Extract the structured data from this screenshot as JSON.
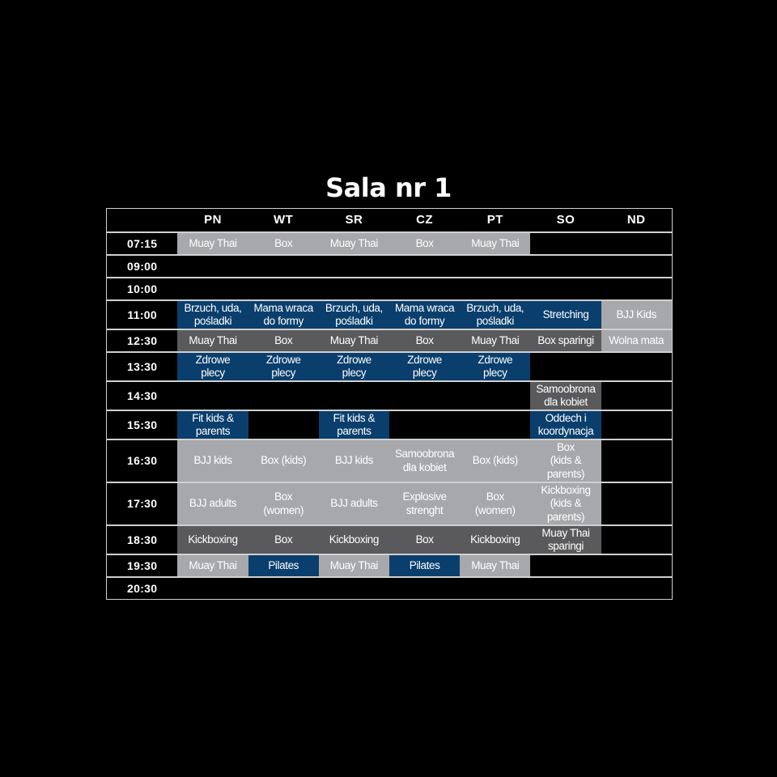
{
  "title": "Sala nr 1",
  "days": [
    "PN",
    "WT",
    "SR",
    "CZ",
    "PT",
    "SO",
    "ND"
  ],
  "colors": {
    "light": "#a7a8ab",
    "dark": "#5a5a5c",
    "blue": "#0a3f6d",
    "border": "#d0d0d0",
    "background": "#000000"
  },
  "rows": [
    {
      "time": "07:15",
      "cells": [
        {
          "label": "Muay Thai",
          "color": "light"
        },
        {
          "label": "Box",
          "color": "light"
        },
        {
          "label": "Muay Thai",
          "color": "light"
        },
        {
          "label": "Box",
          "color": "light"
        },
        {
          "label": "Muay Thai",
          "color": "light"
        },
        null,
        null
      ]
    },
    {
      "time": "09:00",
      "cells": [
        null,
        null,
        null,
        null,
        null,
        null,
        null
      ]
    },
    {
      "time": "10:00",
      "cells": [
        null,
        null,
        null,
        null,
        null,
        null,
        null
      ]
    },
    {
      "time": "11:00",
      "cells": [
        {
          "label": "Brzuch, uda,\npośladki",
          "color": "blue"
        },
        {
          "label": "Mama wraca\ndo formy",
          "color": "blue"
        },
        {
          "label": "Brzuch, uda,\npośladki",
          "color": "blue"
        },
        {
          "label": "Mama wraca\ndo formy",
          "color": "blue"
        },
        {
          "label": "Brzuch, uda,\npośladki",
          "color": "blue"
        },
        {
          "label": "Stretching",
          "color": "blue"
        },
        {
          "label": "BJJ Kids",
          "color": "light"
        }
      ]
    },
    {
      "time": "12:30",
      "cells": [
        {
          "label": "Muay Thai",
          "color": "dark"
        },
        {
          "label": "Box",
          "color": "dark"
        },
        {
          "label": "Muay Thai",
          "color": "dark"
        },
        {
          "label": "Box",
          "color": "dark"
        },
        {
          "label": "Muay Thai",
          "color": "dark"
        },
        {
          "label": "Box sparingi",
          "color": "dark"
        },
        {
          "label": "Wolna mata",
          "color": "light"
        }
      ]
    },
    {
      "time": "13:30",
      "cells": [
        {
          "label": "Zdrowe\nplecy",
          "color": "blue"
        },
        {
          "label": "Zdrowe\nplecy",
          "color": "blue"
        },
        {
          "label": "Zdrowe\nplecy",
          "color": "blue"
        },
        {
          "label": "Zdrowe\nplecy",
          "color": "blue"
        },
        {
          "label": "Zdrowe\nplecy",
          "color": "blue"
        },
        null,
        null
      ]
    },
    {
      "time": "14:30",
      "cells": [
        null,
        null,
        null,
        null,
        null,
        {
          "label": "Samoobrona\ndla kobiet",
          "color": "dark"
        },
        null
      ]
    },
    {
      "time": "15:30",
      "cells": [
        {
          "label": "Fit kids &\nparents",
          "color": "blue"
        },
        null,
        {
          "label": "Fit kids &\nparents",
          "color": "blue"
        },
        null,
        null,
        {
          "label": "Oddech i\nkoordynacja",
          "color": "blue"
        },
        null
      ]
    },
    {
      "time": "16:30",
      "cells": [
        {
          "label": "BJJ kids",
          "color": "light"
        },
        {
          "label": "Box (kids)",
          "color": "light"
        },
        {
          "label": "BJJ kids",
          "color": "light"
        },
        {
          "label": "Samoobrona\ndla kobiet",
          "color": "light"
        },
        {
          "label": "Box (kids)",
          "color": "light"
        },
        {
          "label": "Box\n(kids &\nparents)",
          "color": "light"
        },
        null
      ]
    },
    {
      "time": "17:30",
      "cells": [
        {
          "label": "BJJ adults",
          "color": "light"
        },
        {
          "label": "Box\n(women)",
          "color": "light"
        },
        {
          "label": "BJJ adults",
          "color": "light"
        },
        {
          "label": "Explosive\nstrenght",
          "color": "light"
        },
        {
          "label": "Box\n(women)",
          "color": "light"
        },
        {
          "label": "Kickboxing\n(kids &\nparents)",
          "color": "light"
        },
        null
      ]
    },
    {
      "time": "18:30",
      "cells": [
        {
          "label": "Kickboxing",
          "color": "dark"
        },
        {
          "label": "Box",
          "color": "dark"
        },
        {
          "label": "Kickboxing",
          "color": "dark"
        },
        {
          "label": "Box",
          "color": "dark"
        },
        {
          "label": "Kickboxing",
          "color": "dark"
        },
        {
          "label": "Muay Thai\nsparingi",
          "color": "dark"
        },
        null
      ]
    },
    {
      "time": "19:30",
      "cells": [
        {
          "label": "Muay Thai",
          "color": "light"
        },
        {
          "label": "Pilates",
          "color": "blue"
        },
        {
          "label": "Muay Thai",
          "color": "light"
        },
        {
          "label": "Pilates",
          "color": "blue"
        },
        {
          "label": "Muay Thai",
          "color": "light"
        },
        null,
        null
      ]
    },
    {
      "time": "20:30",
      "cells": [
        null,
        null,
        null,
        null,
        null,
        null,
        null
      ]
    }
  ]
}
